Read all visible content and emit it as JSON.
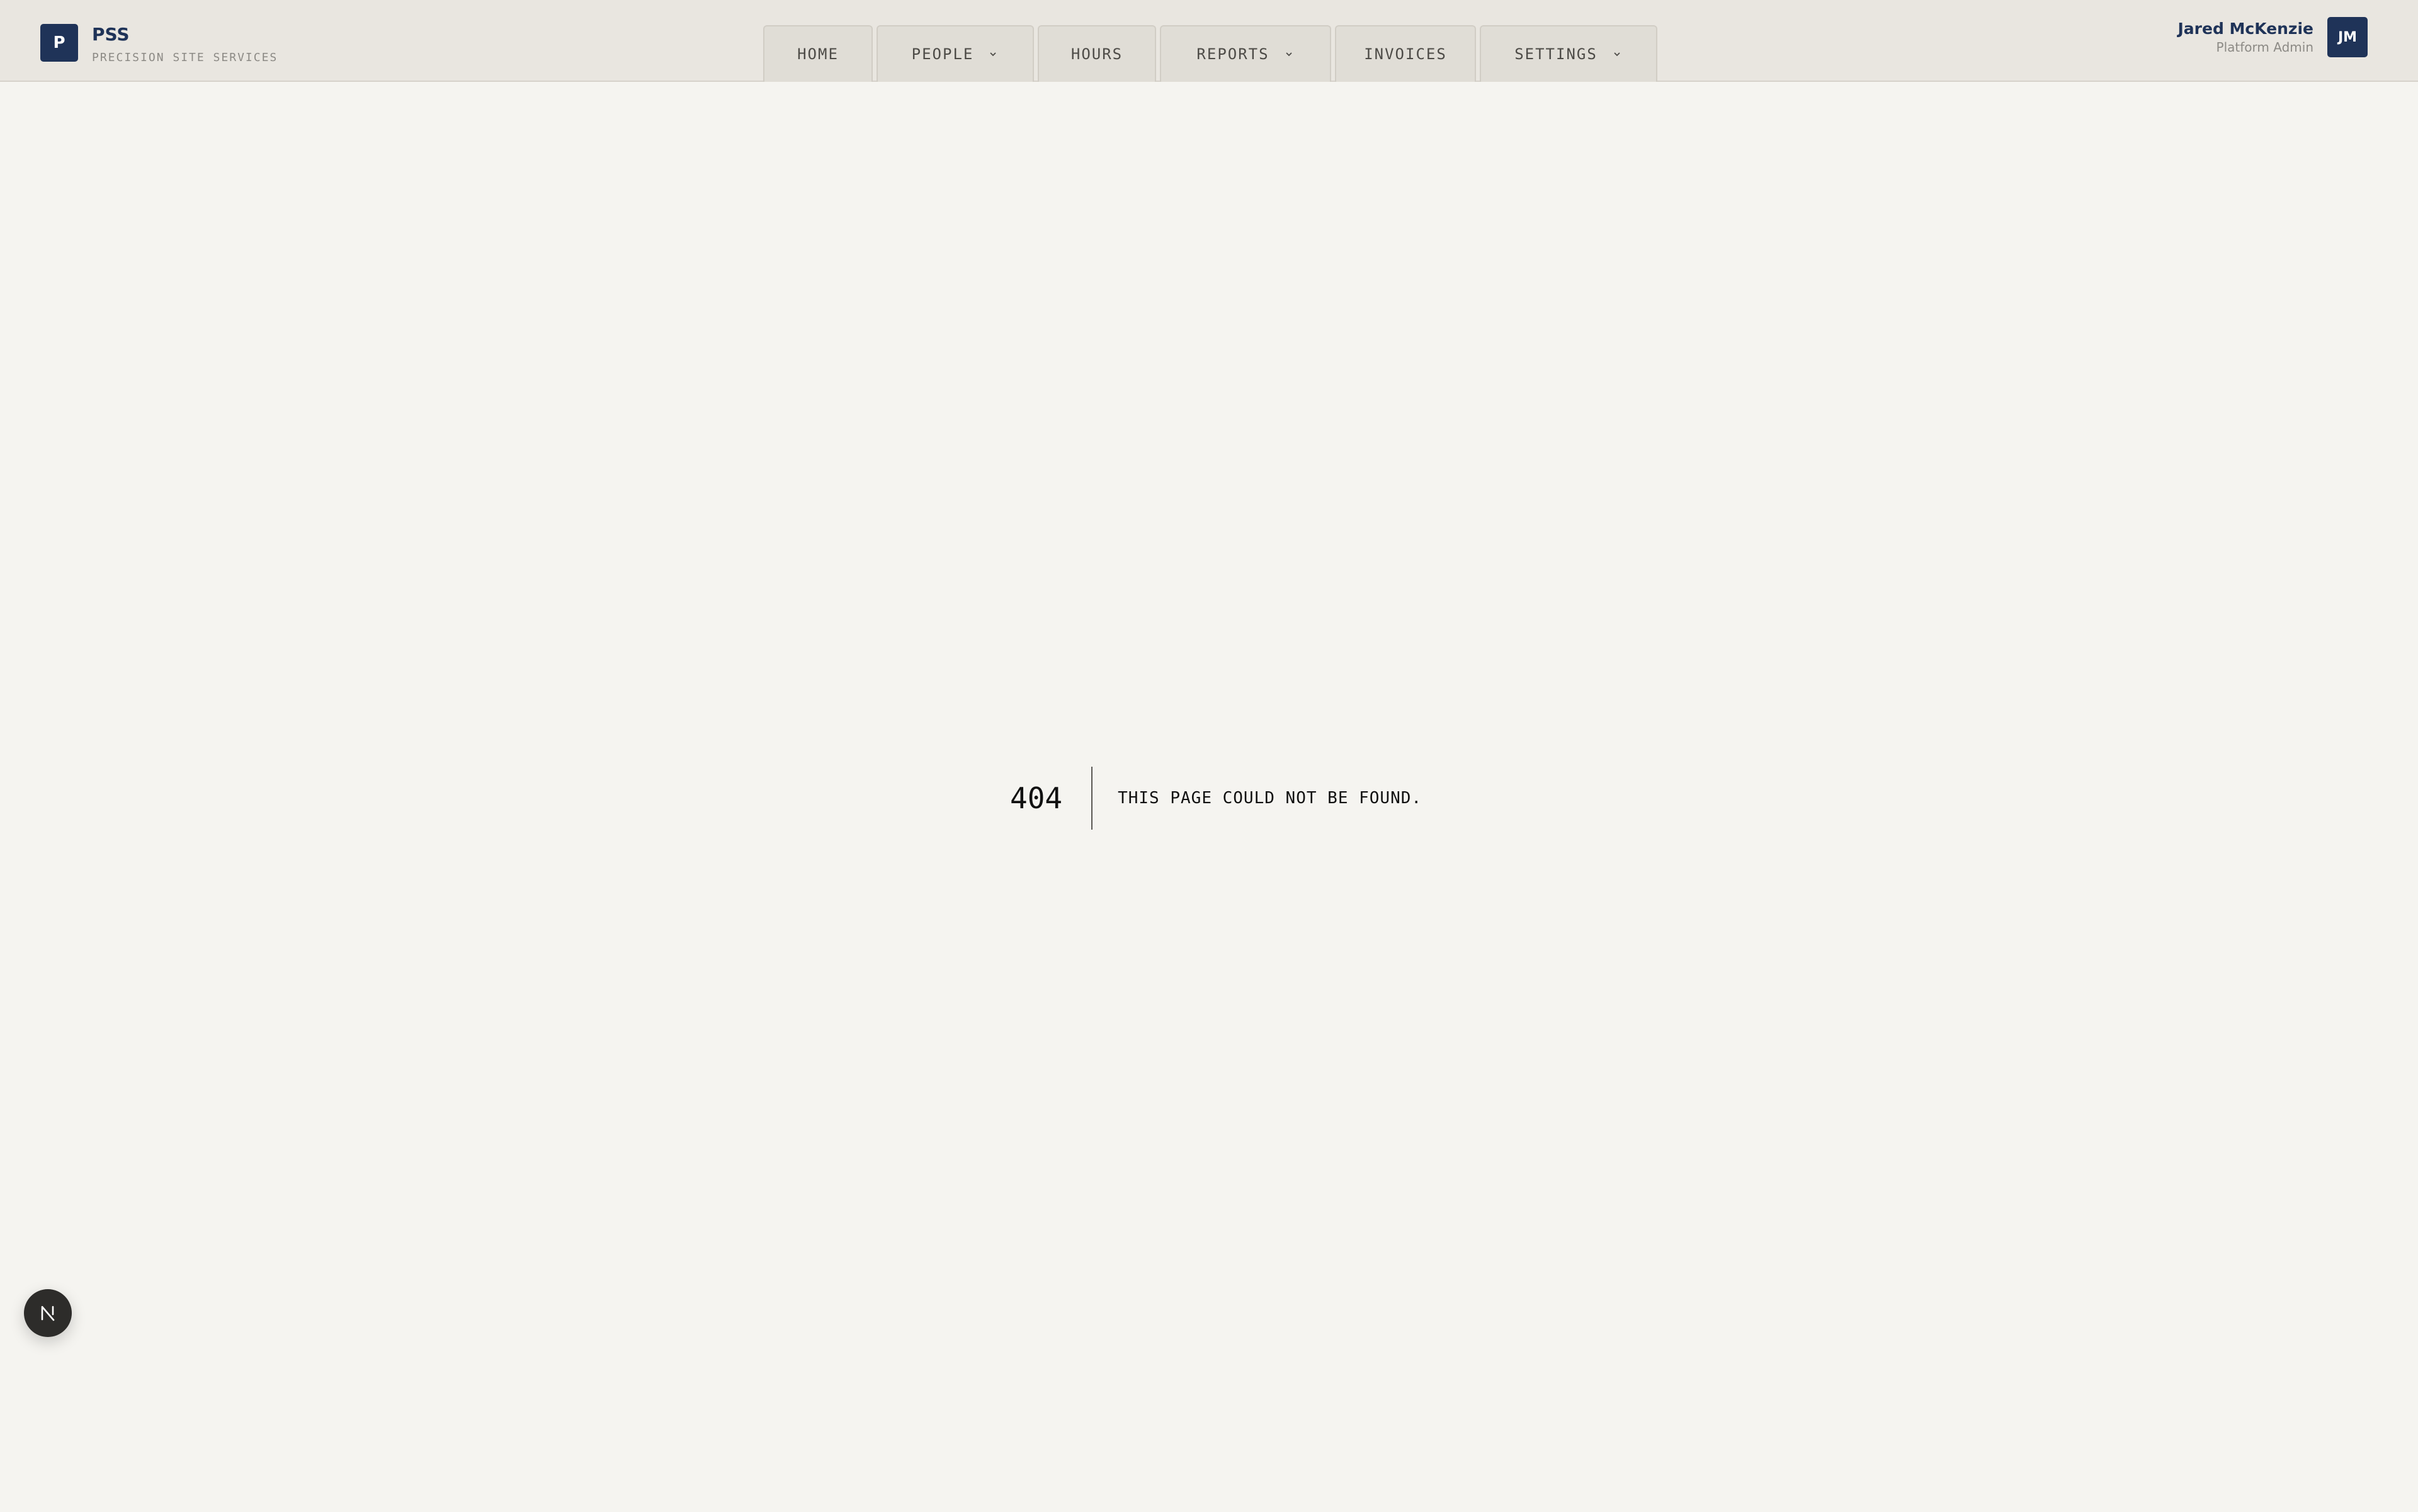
{
  "brand": {
    "mark": "P",
    "name": "PSS",
    "subtitle": "PRECISION SITE SERVICES"
  },
  "nav": {
    "tabs": [
      {
        "label": "HOME",
        "has_dropdown": false
      },
      {
        "label": "PEOPLE",
        "has_dropdown": true
      },
      {
        "label": "HOURS",
        "has_dropdown": false
      },
      {
        "label": "REPORTS",
        "has_dropdown": true
      },
      {
        "label": "INVOICES",
        "has_dropdown": false
      },
      {
        "label": "SETTINGS",
        "has_dropdown": true
      }
    ]
  },
  "user": {
    "name": "Jared McKenzie",
    "role": "Platform Admin",
    "initials": "JM"
  },
  "error": {
    "code": "404",
    "message": "THIS PAGE COULD NOT BE FOUND."
  },
  "fab": {
    "icon": "nextjs-logo-icon"
  },
  "colors": {
    "accent": "#1f3358",
    "background": "#f5f4f0",
    "topbar": "#e9e6e0",
    "tab": "#e0ddd6"
  }
}
